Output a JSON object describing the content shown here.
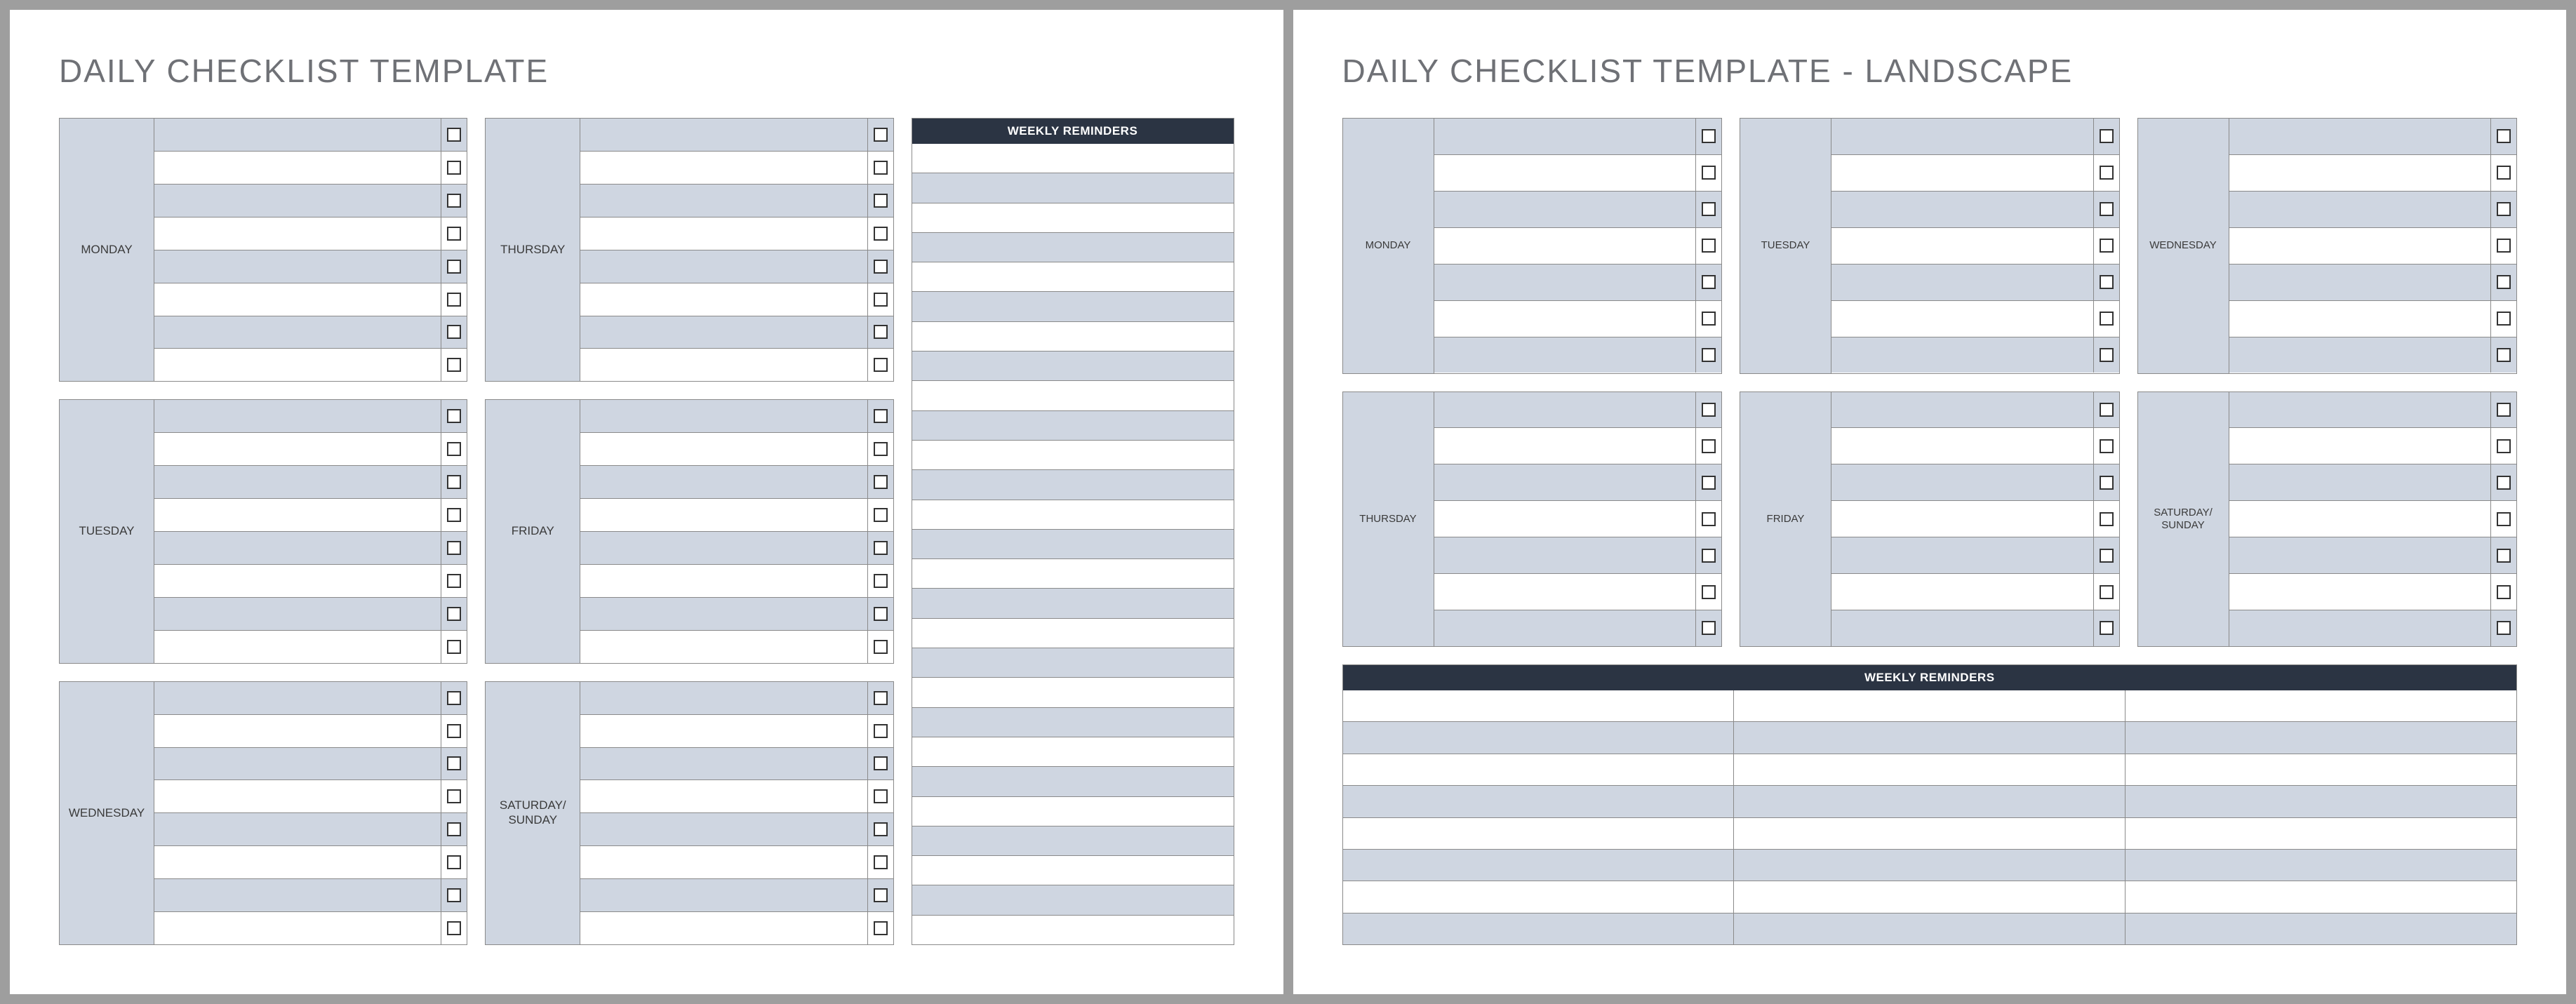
{
  "portrait": {
    "title": "DAILY CHECKLIST TEMPLATE",
    "column1_days": [
      {
        "label": "MONDAY",
        "rows": 8
      },
      {
        "label": "TUESDAY",
        "rows": 8
      },
      {
        "label": "WEDNESDAY",
        "rows": 8
      }
    ],
    "column2_days": [
      {
        "label": "THURSDAY",
        "rows": 8
      },
      {
        "label": "FRIDAY",
        "rows": 8
      },
      {
        "label": "SATURDAY/\nSUNDAY",
        "rows": 8
      }
    ],
    "reminders": {
      "header": "WEEKLY REMINDERS",
      "rows": 27
    }
  },
  "landscape": {
    "title": "DAILY CHECKLIST TEMPLATE - LANDSCAPE",
    "row1_days": [
      {
        "label": "MONDAY",
        "rows": 7
      },
      {
        "label": "TUESDAY",
        "rows": 7
      },
      {
        "label": "WEDNESDAY",
        "rows": 7
      }
    ],
    "row2_days": [
      {
        "label": "THURSDAY",
        "rows": 7
      },
      {
        "label": "FRIDAY",
        "rows": 7
      },
      {
        "label": "SATURDAY/\nSUNDAY",
        "rows": 7
      }
    ],
    "reminders": {
      "header": "WEEKLY REMINDERS",
      "rows": 8,
      "cols": 3
    }
  }
}
